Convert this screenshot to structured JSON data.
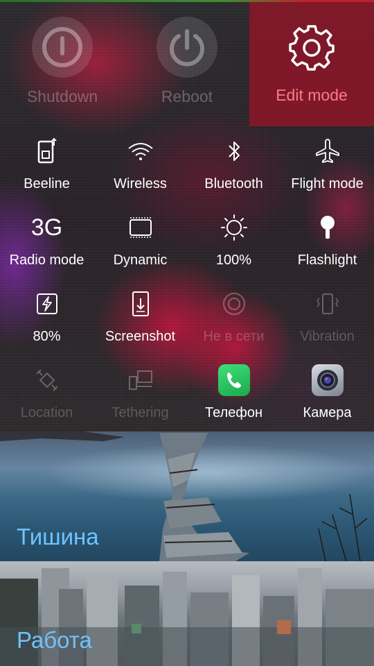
{
  "power": {
    "shutdown_label": "Shutdown",
    "reboot_label": "Reboot",
    "edit_mode_label": "Edit mode"
  },
  "toggles": {
    "row1": [
      {
        "label": "Beeline",
        "icon": "sim-card-icon"
      },
      {
        "label": "Wireless",
        "icon": "wifi-icon"
      },
      {
        "label": "Bluetooth",
        "icon": "bluetooth-icon"
      },
      {
        "label": "Flight mode",
        "icon": "airplane-icon"
      }
    ],
    "row2": [
      {
        "label": "Radio mode",
        "value": "3G",
        "icon": "network-type-icon"
      },
      {
        "label": "Dynamic",
        "icon": "display-icon"
      },
      {
        "label": "100%",
        "icon": "brightness-icon"
      },
      {
        "label": "Flashlight",
        "icon": "flashlight-icon"
      }
    ],
    "row3": [
      {
        "label": "80%",
        "icon": "battery-saver-icon"
      },
      {
        "label": "Screenshot",
        "icon": "screenshot-icon"
      },
      {
        "label": "Не в сети",
        "icon": "presence-icon"
      },
      {
        "label": "Vibration",
        "icon": "vibration-icon"
      }
    ],
    "row4": [
      {
        "label": "Location",
        "icon": "location-icon"
      },
      {
        "label": "Tethering",
        "icon": "tethering-icon"
      },
      {
        "label": "Телефон",
        "icon": "phone-app-icon"
      },
      {
        "label": "Камера",
        "icon": "camera-app-icon"
      }
    ]
  },
  "profiles": {
    "quiet": "Тишина",
    "work": "Работа"
  },
  "colors": {
    "accent": "#6fc3ff",
    "edit_mode_bg": "#96142a",
    "edit_mode_text": "#ff7a8a"
  }
}
